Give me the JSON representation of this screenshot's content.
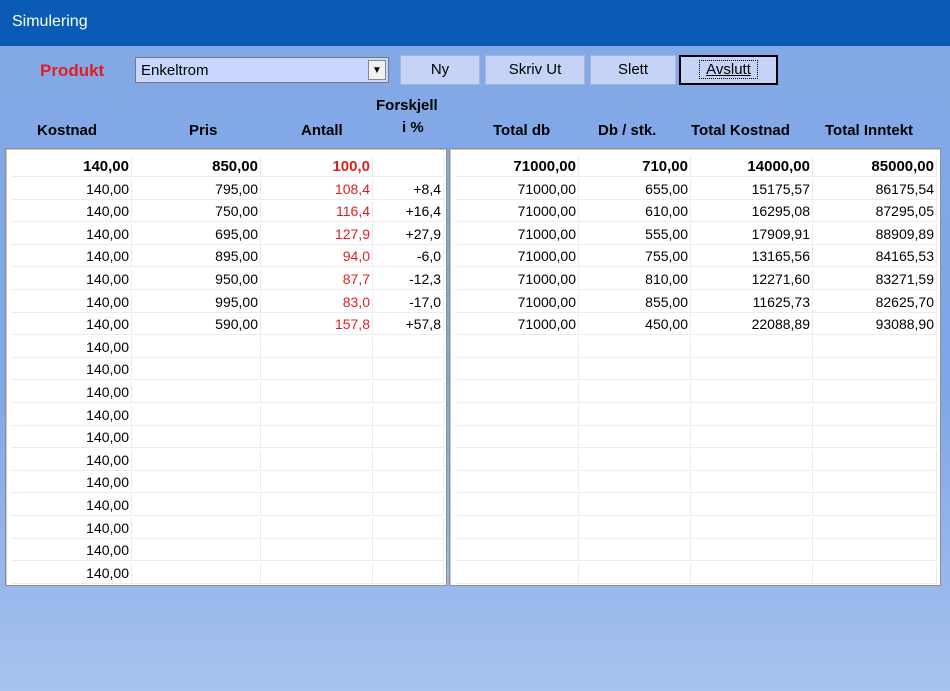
{
  "window": {
    "title": "Simulering"
  },
  "toolbar": {
    "product_label": "Produkt",
    "product_value": "Enkeltrom",
    "buttons": {
      "new": "Ny",
      "print": "Skriv Ut",
      "delete": "Slett",
      "exit": "Avslutt"
    }
  },
  "headers": {
    "kostnad": "Kostnad",
    "pris": "Pris",
    "antall": "Antall",
    "forskjell_1": "Forskjell",
    "forskjell_2": "i %",
    "total_db": "Total db",
    "db_stk": "Db / stk.",
    "total_kostnad": "Total Kostnad",
    "total_inntekt": "Total Inntekt"
  },
  "colors": {
    "accent_red": "#e11e1e",
    "titlebar": "#0a5bb3"
  },
  "rows": [
    {
      "kostnad": "140,00",
      "pris": "850,00",
      "antall": "100,0",
      "forskjell": "",
      "total_db": "71000,00",
      "db_stk": "710,00",
      "total_kostnad": "14000,00",
      "total_inntekt": "85000,00",
      "bold": true
    },
    {
      "kostnad": "140,00",
      "pris": "795,00",
      "antall": "108,4",
      "forskjell": "+8,4",
      "total_db": "71000,00",
      "db_stk": "655,00",
      "total_kostnad": "15175,57",
      "total_inntekt": "86175,54"
    },
    {
      "kostnad": "140,00",
      "pris": "750,00",
      "antall": "116,4",
      "forskjell": "+16,4",
      "total_db": "71000,00",
      "db_stk": "610,00",
      "total_kostnad": "16295,08",
      "total_inntekt": "87295,05"
    },
    {
      "kostnad": "140,00",
      "pris": "695,00",
      "antall": "127,9",
      "forskjell": "+27,9",
      "total_db": "71000,00",
      "db_stk": "555,00",
      "total_kostnad": "17909,91",
      "total_inntekt": "88909,89"
    },
    {
      "kostnad": "140,00",
      "pris": "895,00",
      "antall": "94,0",
      "forskjell": "-6,0",
      "total_db": "71000,00",
      "db_stk": "755,00",
      "total_kostnad": "13165,56",
      "total_inntekt": "84165,53"
    },
    {
      "kostnad": "140,00",
      "pris": "950,00",
      "antall": "87,7",
      "forskjell": "-12,3",
      "total_db": "71000,00",
      "db_stk": "810,00",
      "total_kostnad": "12271,60",
      "total_inntekt": "83271,59"
    },
    {
      "kostnad": "140,00",
      "pris": "995,00",
      "antall": "83,0",
      "forskjell": "-17,0",
      "total_db": "71000,00",
      "db_stk": "855,00",
      "total_kostnad": "11625,73",
      "total_inntekt": "82625,70"
    },
    {
      "kostnad": "140,00",
      "pris": "590,00",
      "antall": "157,8",
      "forskjell": "+57,8",
      "total_db": "71000,00",
      "db_stk": "450,00",
      "total_kostnad": "22088,89",
      "total_inntekt": "93088,90"
    },
    {
      "kostnad": "140,00",
      "pris": "",
      "antall": "",
      "forskjell": "",
      "total_db": "",
      "db_stk": "",
      "total_kostnad": "",
      "total_inntekt": ""
    },
    {
      "kostnad": "140,00",
      "pris": "",
      "antall": "",
      "forskjell": "",
      "total_db": "",
      "db_stk": "",
      "total_kostnad": "",
      "total_inntekt": ""
    },
    {
      "kostnad": "140,00",
      "pris": "",
      "antall": "",
      "forskjell": "",
      "total_db": "",
      "db_stk": "",
      "total_kostnad": "",
      "total_inntekt": ""
    },
    {
      "kostnad": "140,00",
      "pris": "",
      "antall": "",
      "forskjell": "",
      "total_db": "",
      "db_stk": "",
      "total_kostnad": "",
      "total_inntekt": ""
    },
    {
      "kostnad": "140,00",
      "pris": "",
      "antall": "",
      "forskjell": "",
      "total_db": "",
      "db_stk": "",
      "total_kostnad": "",
      "total_inntekt": ""
    },
    {
      "kostnad": "140,00",
      "pris": "",
      "antall": "",
      "forskjell": "",
      "total_db": "",
      "db_stk": "",
      "total_kostnad": "",
      "total_inntekt": ""
    },
    {
      "kostnad": "140,00",
      "pris": "",
      "antall": "",
      "forskjell": "",
      "total_db": "",
      "db_stk": "",
      "total_kostnad": "",
      "total_inntekt": ""
    },
    {
      "kostnad": "140,00",
      "pris": "",
      "antall": "",
      "forskjell": "",
      "total_db": "",
      "db_stk": "",
      "total_kostnad": "",
      "total_inntekt": ""
    },
    {
      "kostnad": "140,00",
      "pris": "",
      "antall": "",
      "forskjell": "",
      "total_db": "",
      "db_stk": "",
      "total_kostnad": "",
      "total_inntekt": ""
    },
    {
      "kostnad": "140,00",
      "pris": "",
      "antall": "",
      "forskjell": "",
      "total_db": "",
      "db_stk": "",
      "total_kostnad": "",
      "total_inntekt": ""
    },
    {
      "kostnad": "140,00",
      "pris": "",
      "antall": "",
      "forskjell": "",
      "total_db": "",
      "db_stk": "",
      "total_kostnad": "",
      "total_inntekt": ""
    }
  ]
}
